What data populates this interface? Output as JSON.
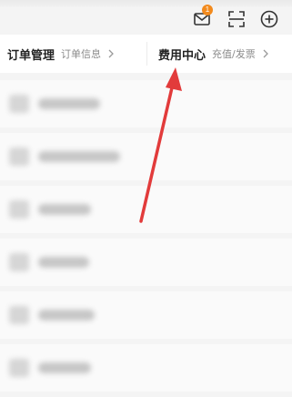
{
  "notification": {
    "badge_count": "1"
  },
  "header": {
    "order": {
      "title": "订单管理",
      "subtitle": "订单信息"
    },
    "fee": {
      "title": "费用中心",
      "subtitle": "充值/发票"
    }
  },
  "icons": [
    "mail-icon",
    "scan-icon",
    "add-icon",
    "chevron-right-icon"
  ],
  "annotation_color": "#e23b3b",
  "list_items": [
    {
      "text": ""
    },
    {
      "text": ""
    },
    {
      "text": ""
    },
    {
      "text": ""
    },
    {
      "text": ""
    },
    {
      "text": ""
    }
  ]
}
